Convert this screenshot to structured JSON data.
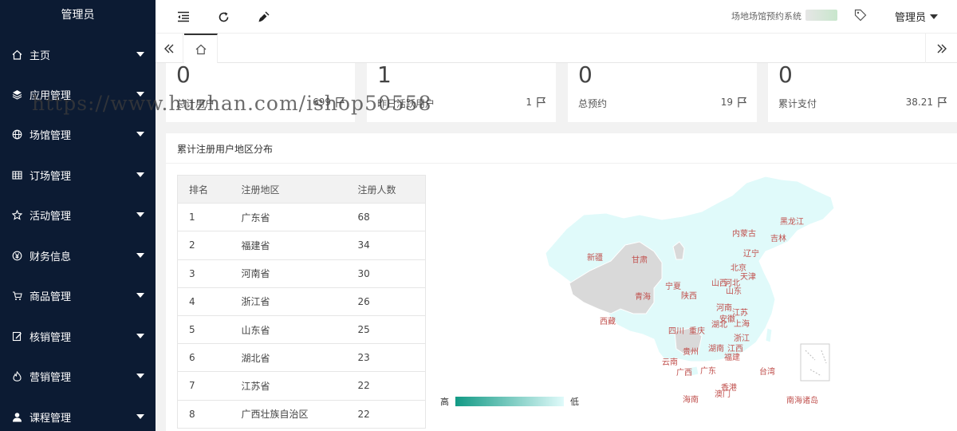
{
  "sidebar": {
    "title": "管理员",
    "items": [
      {
        "label": "主页",
        "icon": "home-icon"
      },
      {
        "label": "应用管理",
        "icon": "layers-icon"
      },
      {
        "label": "场馆管理",
        "icon": "globe-icon"
      },
      {
        "label": "订场管理",
        "icon": "grid-icon"
      },
      {
        "label": "活动管理",
        "icon": "star-icon"
      },
      {
        "label": "财务信息",
        "icon": "yen-icon"
      },
      {
        "label": "商品管理",
        "icon": "cart-icon"
      },
      {
        "label": "核销管理",
        "icon": "edit-icon"
      },
      {
        "label": "营销管理",
        "icon": "fire-icon"
      },
      {
        "label": "课程管理",
        "icon": "user-icon"
      }
    ]
  },
  "header": {
    "system_name": "场地场馆预约系统",
    "user": "管理员"
  },
  "cards": [
    {
      "value": "0",
      "label": "总计用户",
      "num": "699"
    },
    {
      "value": "1",
      "label": "昨日活跃用户",
      "num": "1"
    },
    {
      "value": "0",
      "label": "总预约",
      "num": "19"
    },
    {
      "value": "0",
      "label": "累计支付",
      "num": "38.21"
    }
  ],
  "panel": {
    "title": "累计注册用户地区分布",
    "table": {
      "headers": [
        "排名",
        "注册地区",
        "注册人数"
      ],
      "rows": [
        [
          "1",
          "广东省",
          "68"
        ],
        [
          "2",
          "福建省",
          "34"
        ],
        [
          "3",
          "河南省",
          "30"
        ],
        [
          "4",
          "浙江省",
          "26"
        ],
        [
          "5",
          "山东省",
          "25"
        ],
        [
          "6",
          "湖北省",
          "23"
        ],
        [
          "7",
          "江苏省",
          "22"
        ],
        [
          "8",
          "广西壮族自治区",
          "22"
        ]
      ]
    },
    "legend": {
      "high": "高",
      "low": "低"
    },
    "map_labels": [
      "黑龙江",
      "吉林",
      "内蒙古",
      "辽宁",
      "新疆",
      "甘肃",
      "北京",
      "天津",
      "宁夏",
      "山西",
      "河北",
      "青海",
      "陕西",
      "山东",
      "河南",
      "江苏",
      "西藏",
      "安徽",
      "上海",
      "四川",
      "重庆",
      "湖北",
      "浙江",
      "贵州",
      "湖南",
      "江西",
      "云南",
      "福建",
      "广西",
      "广东",
      "台湾",
      "香港",
      "澳门",
      "海南",
      "南海诸岛"
    ],
    "colors": {
      "province": "#e0fafa",
      "nodata": "#d9d9d9",
      "label": "#c0504d"
    }
  },
  "watermark": "https://www.huzhan.com/ishop50558"
}
